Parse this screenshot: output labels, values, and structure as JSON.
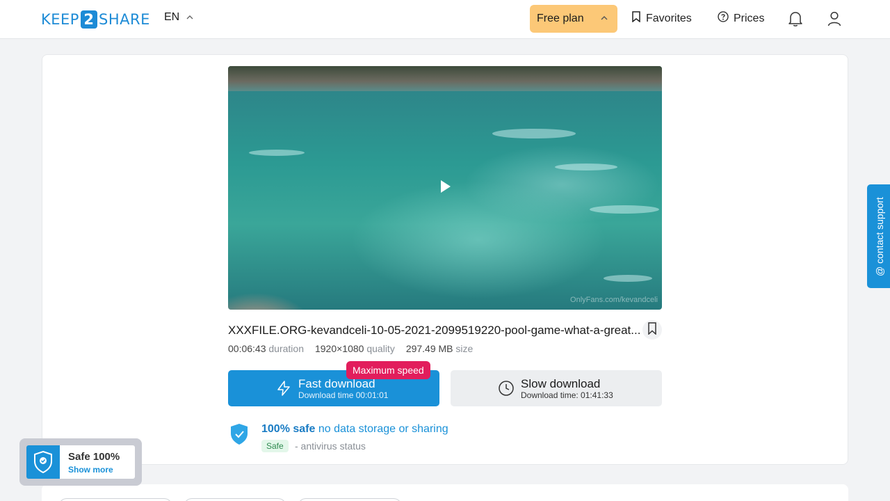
{
  "header": {
    "logo_left": "KEEP",
    "logo_mid": "2",
    "logo_right": "SHARE",
    "language": "EN",
    "plan_label": "Free plan",
    "favorites_label": "Favorites",
    "prices_label": "Prices"
  },
  "video": {
    "watermark": "OnlyFans.com/kevandceli"
  },
  "file": {
    "title": "XXXFILE.ORG-kevandceli-10-05-2021-2099519220-pool-game-what-a-great...",
    "duration_value": "00:06:43",
    "duration_unit": "duration",
    "quality_value": "1920×1080",
    "quality_unit": "quality",
    "size_value": "297.49 MB",
    "size_unit": "size"
  },
  "download": {
    "badge": "Maximum speed",
    "fast_label": "Fast download",
    "fast_time": "Download time 00:01:01",
    "slow_label": "Slow download",
    "slow_time": "Download time: 01:41:33"
  },
  "safety": {
    "headline": "100% safe",
    "link": "no data storage or sharing",
    "tag": "Safe",
    "status": "- antivirus status"
  },
  "support": {
    "label": "@ contact support"
  },
  "widget": {
    "title": "Safe 100%",
    "more": "Show more"
  },
  "colors": {
    "accent": "#1a91d8",
    "plan": "#fcc877",
    "badge": "#e21d5c"
  },
  "icons": [
    "bookmark-icon",
    "question-circle-icon",
    "bell-icon",
    "user-icon",
    "lightning-icon",
    "clock-icon",
    "shield-check-icon",
    "play-icon",
    "chevron-up-icon"
  ]
}
